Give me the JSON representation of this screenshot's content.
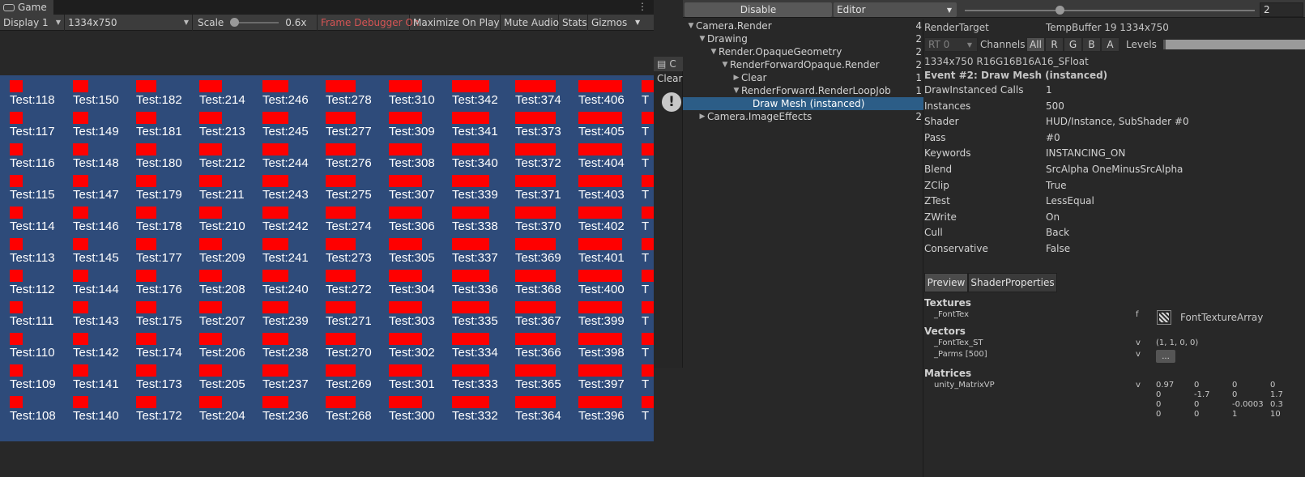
{
  "game": {
    "tab_label": "Game",
    "display": "Display 1",
    "resolution": "1334x750",
    "scale_label": "Scale",
    "scale_value": "0.6x",
    "frame_debugger": "Frame Debugger On",
    "maximize_on_play": "Maximize On Play",
    "mute_audio": "Mute Audio",
    "stats": "Stats",
    "gizmos": "Gizmos",
    "colors": {
      "background": "#2e4b7a",
      "bar": "#ff0000",
      "text": "#ffffff"
    },
    "grid": {
      "columns_start": [
        118,
        150,
        182,
        214,
        246,
        278,
        310,
        342,
        374,
        406
      ],
      "cut_off_column_label": "T",
      "rows_offset": [
        0,
        -1,
        -2,
        -3,
        -4,
        -5,
        -6,
        -7,
        -8,
        -9,
        -10
      ],
      "label_prefix": "Test:"
    }
  },
  "console": {
    "tab_label": "C",
    "clear": "Clear"
  },
  "frame_debugger": {
    "disable_button": "Disable",
    "target": "Editor",
    "event_index": "2",
    "tree": [
      {
        "label": "Camera.Render",
        "count": "4",
        "depth": 0,
        "toggle": "open"
      },
      {
        "label": "Drawing",
        "count": "2",
        "depth": 1,
        "toggle": "open"
      },
      {
        "label": "Render.OpaqueGeometry",
        "count": "2",
        "depth": 2,
        "toggle": "open"
      },
      {
        "label": "RenderForwardOpaque.Render",
        "count": "2",
        "depth": 3,
        "toggle": "open"
      },
      {
        "label": "Clear",
        "count": "1",
        "depth": 4,
        "toggle": "closed"
      },
      {
        "label": "RenderForward.RenderLoopJob",
        "count": "1",
        "depth": 4,
        "toggle": "open"
      },
      {
        "label": "Draw Mesh (instanced)",
        "count": "",
        "depth": 5,
        "toggle": "none",
        "selected": true
      },
      {
        "label": "Camera.ImageEffects",
        "count": "2",
        "depth": 1,
        "toggle": "closed"
      }
    ],
    "details": {
      "render_target_label": "RenderTarget",
      "render_target_value": "TempBuffer 19 1334x750",
      "rt_dropdown": "RT 0",
      "channels_label": "Channels",
      "channels": [
        "All",
        "R",
        "G",
        "B",
        "A"
      ],
      "levels_label": "Levels",
      "format": "1334x750 R16G16B16A16_SFloat",
      "event_title": "Event #2: Draw Mesh (instanced)",
      "properties": [
        {
          "name": "DrawInstanced Calls",
          "value": "1"
        },
        {
          "name": "Instances",
          "value": "500"
        },
        {
          "name": "Shader",
          "value": "HUD/Instance, SubShader #0"
        },
        {
          "name": "Pass",
          "value": "#0"
        },
        {
          "name": "Keywords",
          "value": "INSTANCING_ON"
        },
        {
          "name": "Blend",
          "value": "SrcAlpha OneMinusSrcAlpha"
        },
        {
          "name": "ZClip",
          "value": "True"
        },
        {
          "name": "ZTest",
          "value": "LessEqual"
        },
        {
          "name": "ZWrite",
          "value": "On"
        },
        {
          "name": "Cull",
          "value": "Back"
        },
        {
          "name": "Conservative",
          "value": "False"
        }
      ],
      "tabs": [
        "Preview",
        "ShaderProperties"
      ],
      "textures_head": "Textures",
      "fonttex_name": "_FontTex",
      "fonttex_stage": "f",
      "fonttex_value": "FontTextureArray",
      "vectors_head": "Vectors",
      "fonttex_st_name": "_FontTex_ST",
      "fonttex_st_stage": "v",
      "fonttex_st_value": "(1, 1, 0, 0)",
      "parms_name": "_Parms [500]",
      "parms_stage": "v",
      "parms_button": "...",
      "matrices_head": "Matrices",
      "matrix_name": "unity_MatrixVP",
      "matrix_stage": "v",
      "matrix": [
        [
          "0.97",
          "0",
          "0",
          "0"
        ],
        [
          "0",
          "-1.7",
          "0",
          "1.7"
        ],
        [
          "0",
          "0",
          "-0.0003",
          "0.3"
        ],
        [
          "0",
          "0",
          "1",
          "10"
        ]
      ]
    }
  }
}
